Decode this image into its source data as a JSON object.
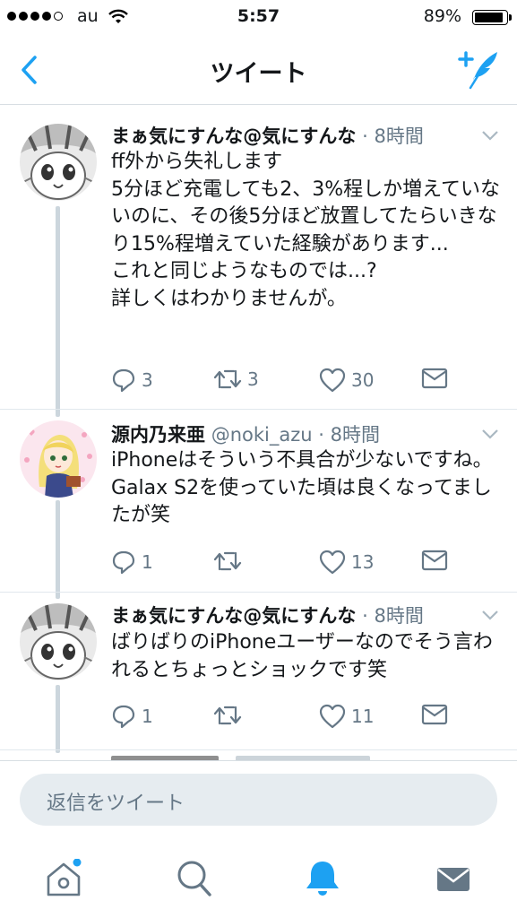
{
  "status_bar": {
    "carrier": "au",
    "time": "5:57",
    "battery": "89%"
  },
  "nav": {
    "title": "ツイート"
  },
  "tweets": [
    {
      "name": "まぁ気にすんな@気にすんな",
      "handle": "",
      "time": "· 8時間",
      "text": "ff外から失礼します\n5分ほど充電しても2、3%程しか増えていないのに、その後5分ほど放置してたらいきなり15%程増えていた経験があります...\nこれと同じようなものでは...?\n詳しくはわかりませんが。",
      "replies": "3",
      "retweets": "3",
      "likes": "30"
    },
    {
      "name": "源内乃来亜",
      "handle": "@noki_azu",
      "time": "· 8時間",
      "text": "iPhoneはそういう不具合が少ないですね。Galax S2を使っていた頃は良くなってましたが笑",
      "replies": "1",
      "retweets": "",
      "likes": "13"
    },
    {
      "name": "まぁ気にすんな@気にすんな",
      "handle": "",
      "time": "· 8時間",
      "text": "ばりばりのiPhoneユーザーなのでそう言われるとちょっとショックです笑",
      "replies": "1",
      "retweets": "",
      "likes": "11"
    }
  ],
  "reply_bar": {
    "placeholder": "返信をツイート"
  },
  "tab_bar": {
    "items": [
      "home-icon",
      "search-icon",
      "notifications-icon",
      "messages-icon"
    ]
  },
  "colors": {
    "accent": "#1da1f2",
    "gray": "#657786",
    "text": "#14171a"
  }
}
